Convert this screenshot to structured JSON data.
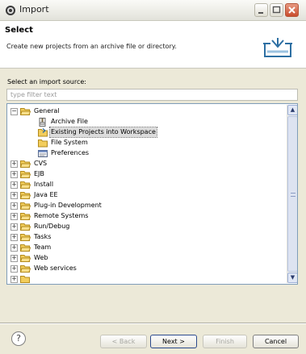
{
  "window": {
    "title": "Import"
  },
  "header": {
    "title": "Select",
    "description": "Create new projects from an archive file or directory."
  },
  "source_label": "Select an import source:",
  "filter": {
    "placeholder": "type filter text",
    "value": ""
  },
  "tree": {
    "general": {
      "label": "General",
      "expanded": true,
      "children": [
        {
          "label": "Archive File",
          "icon": "archive-file-icon"
        },
        {
          "label": "Existing Projects into Workspace",
          "icon": "existing-projects-icon",
          "selected": true
        },
        {
          "label": "File System",
          "icon": "file-system-folder-icon"
        },
        {
          "label": "Preferences",
          "icon": "preferences-icon"
        }
      ]
    },
    "categories": [
      {
        "label": "CVS"
      },
      {
        "label": "EJB"
      },
      {
        "label": "Install"
      },
      {
        "label": "Java EE"
      },
      {
        "label": "Plug-in Development"
      },
      {
        "label": "Remote Systems"
      },
      {
        "label": "Run/Debug"
      },
      {
        "label": "Tasks"
      },
      {
        "label": "Team"
      },
      {
        "label": "Web"
      },
      {
        "label": "Web services"
      }
    ]
  },
  "buttons": {
    "help": "?",
    "back": "< Back",
    "next": "Next >",
    "finish": "Finish",
    "cancel": "Cancel"
  },
  "colors": {
    "window_bg": "#ece9d8",
    "folder": "#f2cd5c",
    "selection": "#dcdcdc",
    "tree_border": "#7f9db9"
  }
}
